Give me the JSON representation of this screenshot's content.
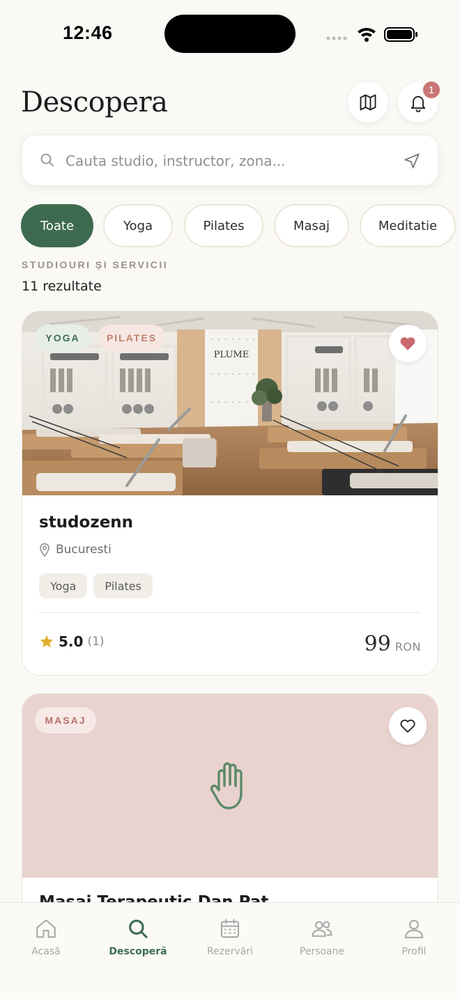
{
  "status_bar": {
    "time": "12:46"
  },
  "header": {
    "title": "Descopera",
    "notification_count": "1"
  },
  "search": {
    "placeholder": "Cauta studio, instructor, zona..."
  },
  "filters": {
    "chips": [
      {
        "label": "Toate",
        "active": true
      },
      {
        "label": "Yoga",
        "active": false
      },
      {
        "label": "Pilates",
        "active": false
      },
      {
        "label": "Masaj",
        "active": false
      },
      {
        "label": "Meditatie",
        "active": false
      }
    ]
  },
  "results": {
    "section_label": "STUDIOURI ȘI SERVICII",
    "count_text": "11 rezultate"
  },
  "cards": [
    {
      "image_tags": [
        "YOGA",
        "PILATES"
      ],
      "favorited": true,
      "image_logo": "PLUME",
      "title": "studozenn",
      "location": "Bucuresti",
      "tags": [
        "Yoga",
        "Pilates"
      ],
      "rating": "5.0",
      "rating_count": "(1)",
      "price": "99",
      "currency": "RON"
    },
    {
      "image_tags": [
        "MASAJ"
      ],
      "favorited": false,
      "title": "Masaj Terapeutic Dan Pat"
    }
  ],
  "tab_bar": {
    "tabs": [
      {
        "label": "Acasă",
        "icon": "home-icon"
      },
      {
        "label": "Descoperă",
        "icon": "search-icon",
        "active": true
      },
      {
        "label": "Rezervări",
        "icon": "calendar-icon"
      },
      {
        "label": "Persoane",
        "icon": "people-icon"
      },
      {
        "label": "Profil",
        "icon": "profile-icon"
      }
    ]
  },
  "colors": {
    "accent_green": "#3e6b50",
    "favorite_red": "#c9696e",
    "masaj_pink": "#e9d3cf",
    "background": "#faf9f5"
  }
}
